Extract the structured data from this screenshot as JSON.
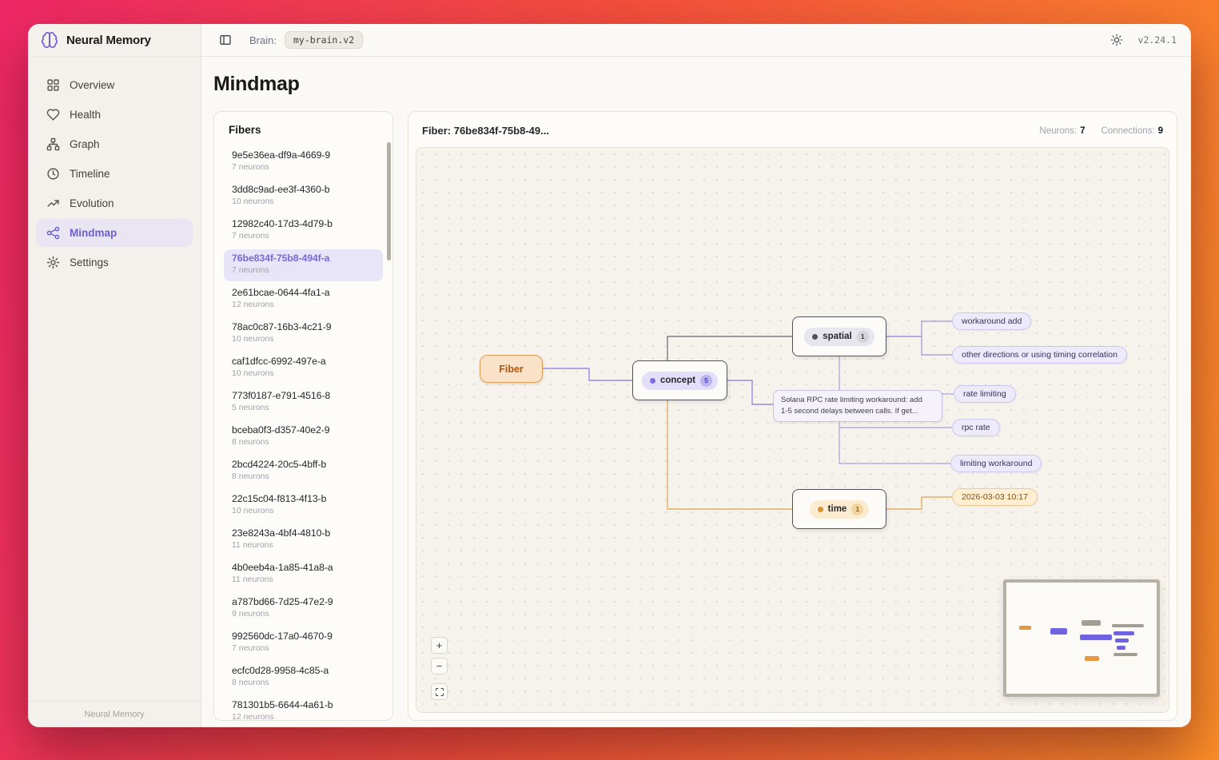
{
  "app": {
    "name": "Neural Memory",
    "version": "v2.24.1",
    "footer": "Neural Memory"
  },
  "topbar": {
    "brain_label": "Brain:",
    "brain_value": "my-brain.v2"
  },
  "sidebar": {
    "items": [
      {
        "label": "Overview"
      },
      {
        "label": "Health"
      },
      {
        "label": "Graph"
      },
      {
        "label": "Timeline"
      },
      {
        "label": "Evolution"
      },
      {
        "label": "Mindmap",
        "active": true
      },
      {
        "label": "Settings"
      }
    ]
  },
  "page": {
    "title": "Mindmap"
  },
  "fibers": {
    "title": "Fibers",
    "items": [
      {
        "id": "9e5e36ea-df9a-4669-9",
        "neurons": "7 neurons"
      },
      {
        "id": "3dd8c9ad-ee3f-4360-b",
        "neurons": "10 neurons"
      },
      {
        "id": "12982c40-17d3-4d79-b",
        "neurons": "7 neurons"
      },
      {
        "id": "76be834f-75b8-494f-a",
        "neurons": "7 neurons",
        "selected": true
      },
      {
        "id": "2e61bcae-0644-4fa1-a",
        "neurons": "12 neurons"
      },
      {
        "id": "78ac0c87-16b3-4c21-9",
        "neurons": "10 neurons"
      },
      {
        "id": "caf1dfcc-6992-497e-a",
        "neurons": "10 neurons"
      },
      {
        "id": "773f0187-e791-4516-8",
        "neurons": "5 neurons"
      },
      {
        "id": "bceba0f3-d357-40e2-9",
        "neurons": "8 neurons"
      },
      {
        "id": "2bcd4224-20c5-4bff-b",
        "neurons": "8 neurons"
      },
      {
        "id": "22c15c04-f813-4f13-b",
        "neurons": "10 neurons"
      },
      {
        "id": "23e8243a-4bf4-4810-b",
        "neurons": "11 neurons"
      },
      {
        "id": "4b0eeb4a-1a85-41a8-a",
        "neurons": "11 neurons"
      },
      {
        "id": "a787bd66-7d25-47e2-9",
        "neurons": "9 neurons"
      },
      {
        "id": "992560dc-17a0-4670-9",
        "neurons": "7 neurons"
      },
      {
        "id": "ecfc0d28-9958-4c85-a",
        "neurons": "8 neurons"
      },
      {
        "id": "781301b5-6644-4a61-b",
        "neurons": "12 neurons"
      }
    ]
  },
  "detail": {
    "title": "Fiber: 76be834f-75b8-49...",
    "neurons_label": "Neurons:",
    "neurons_value": "7",
    "connections_label": "Connections:",
    "connections_value": "9"
  },
  "mindmap": {
    "fiber_node_label": "Fiber",
    "groups": [
      {
        "label": "concept",
        "badge": "5"
      },
      {
        "label": "spatial",
        "badge": "1"
      },
      {
        "label": "time",
        "badge": "1"
      }
    ],
    "note": {
      "line1": "Solana RPC rate limiting workaround: add",
      "line2": "1-5 second delays between calls. If get..."
    },
    "leaves": [
      {
        "label": "workaround add"
      },
      {
        "label": "other directions or using timing correlation"
      },
      {
        "label": "rate limiting"
      },
      {
        "label": "rpc rate"
      },
      {
        "label": "limiting workaround"
      },
      {
        "label": "2026-03-03 10:17"
      }
    ]
  },
  "controls": {
    "zoom_in": "+",
    "zoom_out": "−"
  },
  "colors": {
    "accent_purple": "#6c5fd0",
    "accent_orange": "#e0913a",
    "selected_fiber": "#776ad8",
    "gradient_start": "#ef2767",
    "gradient_end": "#fc8f28"
  }
}
